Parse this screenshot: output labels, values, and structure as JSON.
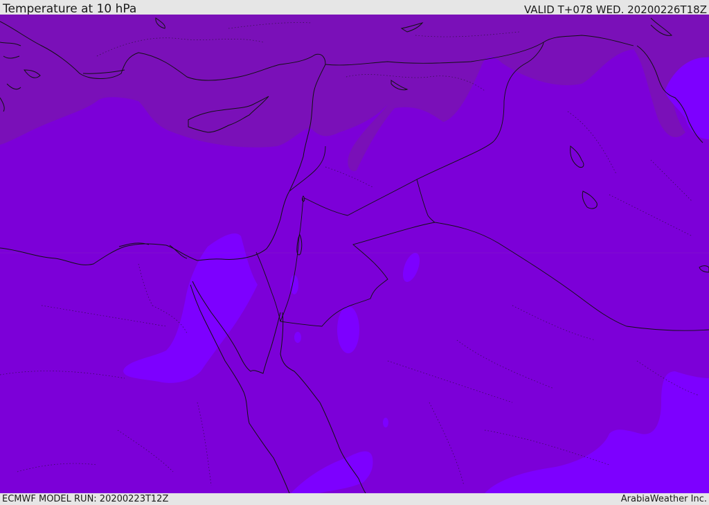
{
  "header": {
    "title": "Temperature at 10 hPa",
    "valid": "VALID T+078 WED. 20200226T18Z"
  },
  "footer": {
    "model_run": "ECMWF MODEL RUN: 20200223T12Z",
    "credit": "ArabiaWeather Inc."
  },
  "map": {
    "field": "Temperature at 10 hPa",
    "colors": {
      "base": "#7c00d8",
      "cold_band": "#7a10b8",
      "warm_patch": "#7d00ff",
      "coastline": "#111111",
      "border": "#111111"
    },
    "icons": [
      "coastline",
      "country-border",
      "internal-boundary"
    ]
  }
}
